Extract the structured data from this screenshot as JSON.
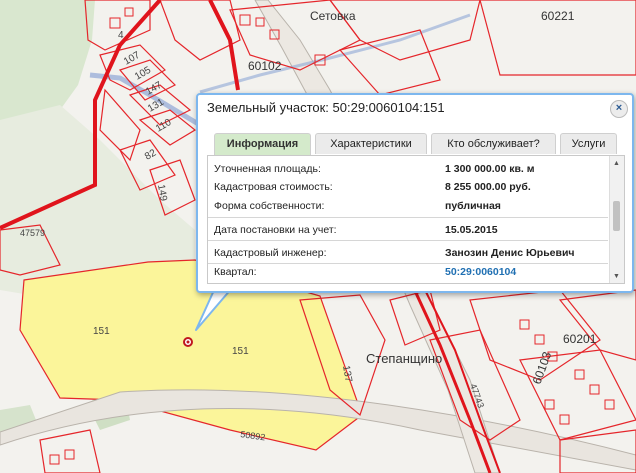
{
  "map": {
    "places": {
      "setovka": "Сетовка",
      "stepanshchino": "Степанщино"
    },
    "quarters": {
      "q60221": "60221",
      "q60102": "60102",
      "q60201": "60201",
      "q60103": "60103"
    },
    "roads": {
      "r47579": "47579",
      "r50892": "50892",
      "r47743": "47743"
    },
    "parcels": {
      "p4": "4",
      "p107": "107",
      "p105": "105",
      "p147": "147",
      "p131": "131",
      "p110": "110",
      "p82": "82",
      "p149": "149",
      "p151a": "151",
      "p151b": "151",
      "p137": "137"
    }
  },
  "popup": {
    "title": "Земельный участок: 50:29:0060104:151",
    "close": "×",
    "tabs": [
      "Информация",
      "Характеристики",
      "Кто обслуживает?",
      "Услуги"
    ],
    "rows": [
      {
        "key": "Уточненная площадь:",
        "value": "1 300 000.00 кв. м"
      },
      {
        "key": "Кадастровая стоимость:",
        "value": "8 255 000.00 руб."
      },
      {
        "key": "Форма собственности:",
        "value": "публичная"
      },
      {
        "key": "Дата постановки на учет:",
        "value": "15.05.2015"
      },
      {
        "key": "Кадастровый инженер:",
        "value": "Занозин Денис Юрьевич"
      },
      {
        "key": "Квартал:",
        "value": "50:29:0060104"
      }
    ],
    "scroll_up": "▲",
    "scroll_down": "▼"
  },
  "colors": {
    "parcel_red": "#e5262b",
    "boundary_red": "#e0141c",
    "highlight_yellow": "#fbf59a",
    "road_gray": "#b9b3ab",
    "popup_border": "#7db7ee",
    "link_blue": "#1f6fb2"
  }
}
